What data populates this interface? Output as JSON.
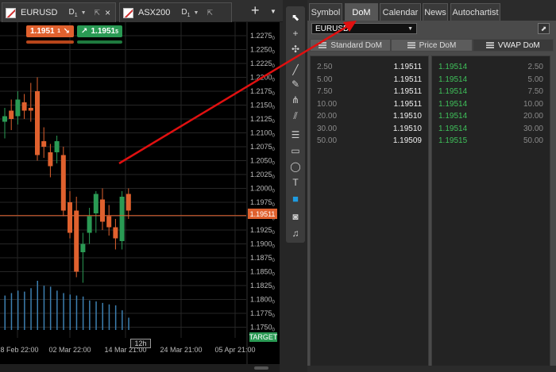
{
  "chart_tabs": [
    {
      "symbol": "EURUSD",
      "timeframe": "D",
      "timeframe_sub": "1"
    },
    {
      "symbol": "ASX200",
      "timeframe": "D",
      "timeframe_sub": "1"
    }
  ],
  "trade": {
    "sell_price": "1.1951",
    "sell_sup": "1",
    "buy_price": "1.1951",
    "buy_sup": "5"
  },
  "chart": {
    "current_price": "1.19511",
    "target_label": "TARGET",
    "timeframe_tag": "12h",
    "y_ticks": [
      "1.2275",
      "1.2250",
      "1.2225",
      "1.2200",
      "1.2175",
      "1.2150",
      "1.2125",
      "1.2100",
      "1.2075",
      "1.2050",
      "1.2025",
      "1.2000",
      "1.1975",
      "1.1950",
      "1.1925",
      "1.1900",
      "1.1875",
      "1.1850",
      "1.1825",
      "1.1800",
      "1.1775",
      "1.1750"
    ],
    "y_tick_suffix": "0",
    "x_ticks": [
      "18 Feb 22:00",
      "02 Mar 22:00",
      "14 Mar 21:00",
      "24 Mar 21:00",
      "05 Apr 21:00"
    ],
    "colors": {
      "up": "#2a9a54",
      "down": "#e0612e",
      "volume": "#3d7fb0",
      "grid": "#262626"
    }
  },
  "chart_data": {
    "type": "candlestick",
    "ylim": [
      1.1745,
      1.2285
    ],
    "candles": [
      {
        "o": 1.212,
        "h": 1.2145,
        "l": 1.209,
        "c": 1.213
      },
      {
        "o": 1.214,
        "h": 1.216,
        "l": 1.2105,
        "c": 1.2125
      },
      {
        "o": 1.213,
        "h": 1.2175,
        "l": 1.2115,
        "c": 1.216
      },
      {
        "o": 1.2155,
        "h": 1.217,
        "l": 1.2125,
        "c": 1.214
      },
      {
        "o": 1.2145,
        "h": 1.219,
        "l": 1.212,
        "c": 1.214
      },
      {
        "o": 1.2175,
        "h": 1.22,
        "l": 1.205,
        "c": 1.206
      },
      {
        "o": 1.2085,
        "h": 1.211,
        "l": 1.2055,
        "c": 1.2075
      },
      {
        "o": 1.2065,
        "h": 1.208,
        "l": 1.202,
        "c": 1.204
      },
      {
        "o": 1.2065,
        "h": 1.2095,
        "l": 1.2045,
        "c": 1.2085
      },
      {
        "o": 1.206,
        "h": 1.2075,
        "l": 1.195,
        "c": 1.196
      },
      {
        "o": 1.1975,
        "h": 1.1995,
        "l": 1.191,
        "c": 1.192
      },
      {
        "o": 1.196,
        "h": 1.1985,
        "l": 1.184,
        "c": 1.185
      },
      {
        "o": 1.1885,
        "h": 1.192,
        "l": 1.183,
        "c": 1.19
      },
      {
        "o": 1.192,
        "h": 1.1965,
        "l": 1.19,
        "c": 1.195
      },
      {
        "o": 1.1955,
        "h": 1.1995,
        "l": 1.192,
        "c": 1.199
      },
      {
        "o": 1.198,
        "h": 1.2,
        "l": 1.1925,
        "c": 1.194
      },
      {
        "o": 1.195,
        "h": 1.197,
        "l": 1.1915,
        "c": 1.193
      },
      {
        "o": 1.193,
        "h": 1.1945,
        "l": 1.189,
        "c": 1.191
      },
      {
        "o": 1.1905,
        "h": 1.1995,
        "l": 1.189,
        "c": 1.1985
      },
      {
        "o": 1.199,
        "h": 1.2,
        "l": 1.1945,
        "c": 1.196
      }
    ],
    "volumes": [
      0.7,
      0.75,
      0.8,
      0.78,
      0.85,
      1.0,
      0.9,
      0.88,
      0.8,
      0.75,
      0.72,
      0.7,
      0.68,
      0.6,
      0.58,
      0.55,
      0.52,
      0.5,
      0.4,
      0.25
    ],
    "ylabel": "",
    "xlabel": ""
  },
  "draw_tools": [
    {
      "name": "cursor",
      "glyph": "⬉"
    },
    {
      "name": "crosshair",
      "glyph": "+"
    },
    {
      "name": "zoom",
      "glyph": "✣"
    },
    {
      "name": "trend-line",
      "glyph": "╱"
    },
    {
      "name": "pen",
      "glyph": "✎"
    },
    {
      "name": "pitchfork",
      "glyph": "⋔"
    },
    {
      "name": "channel",
      "glyph": "⫽"
    },
    {
      "name": "fibonacci",
      "glyph": "☰"
    },
    {
      "name": "rectangle",
      "glyph": "▭"
    },
    {
      "name": "ellipse",
      "glyph": "◯"
    },
    {
      "name": "text",
      "glyph": "T"
    },
    {
      "name": "color",
      "glyph": "■"
    },
    {
      "name": "camera",
      "glyph": "◙"
    },
    {
      "name": "alert",
      "glyph": "♫"
    }
  ],
  "panel_tabs": [
    "Symbol",
    "DoM",
    "Calendar",
    "News",
    "Autochartist"
  ],
  "panel": {
    "symbol": "EURUSD",
    "dom_tabs": [
      "Standard DoM",
      "Price DoM",
      "VWAP DoM"
    ],
    "bid_rows": [
      {
        "size": "2.50",
        "price": "1.19511"
      },
      {
        "size": "5.00",
        "price": "1.19511"
      },
      {
        "size": "7.50",
        "price": "1.19511"
      },
      {
        "size": "10.00",
        "price": "1.19511"
      },
      {
        "size": "20.00",
        "price": "1.19510"
      },
      {
        "size": "30.00",
        "price": "1.19510"
      },
      {
        "size": "50.00",
        "price": "1.19509"
      }
    ],
    "ask_rows": [
      {
        "price": "1.19514",
        "size": "2.50"
      },
      {
        "price": "1.19514",
        "size": "5.00"
      },
      {
        "price": "1.19514",
        "size": "7.50"
      },
      {
        "price": "1.19514",
        "size": "10.00"
      },
      {
        "price": "1.19514",
        "size": "20.00"
      },
      {
        "price": "1.19514",
        "size": "30.00"
      },
      {
        "price": "1.19515",
        "size": "50.00"
      }
    ]
  }
}
